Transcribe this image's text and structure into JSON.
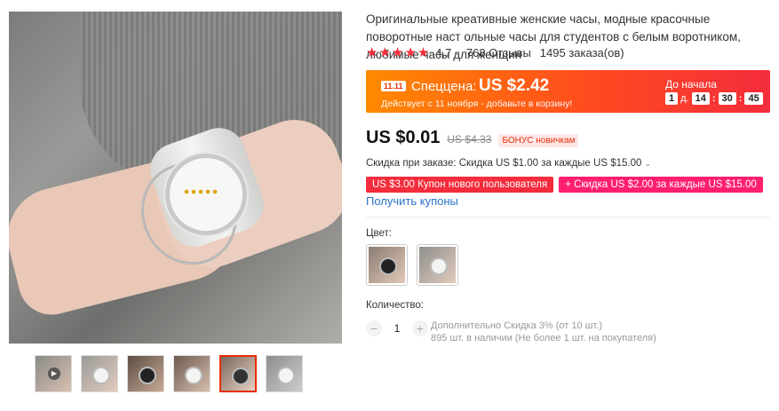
{
  "product": {
    "title": "Оригинальные креативные женские часы, модные красочные поворотные наст ольные часы для студентов с белым воротником, любимые часы для женщин",
    "stars": "★★★★★",
    "rating": "4.7",
    "reviews": "768 Отзывы",
    "orders": "1495 заказа(ов)"
  },
  "promo_banner": {
    "badge": "11.11",
    "special_label": "Спеццена:",
    "special_price": "US $2.42",
    "subtitle": "Действует с 11 ноября - добавьте в корзину!",
    "countdown_label": "До начала",
    "days": "1",
    "days_unit": "д.",
    "hours": "14",
    "minutes": "30",
    "seconds": "45",
    "sep": ":"
  },
  "price": {
    "current": "US $0.01",
    "old": "US $4.33",
    "bonus": "БОНУС новичкам"
  },
  "discount": {
    "text": "Скидка при заказе: Скидка US $1.00 за каждые US $15.00"
  },
  "coupons": [
    {
      "label": "US $3.00 Купон нового пользователя"
    },
    {
      "label": "+ Скидка US $2.00 за каждые US $15.00"
    }
  ],
  "get_coupons": "Получить купоны",
  "color": {
    "label": "Цвет:"
  },
  "quantity": {
    "label": "Количество:",
    "minus": "−",
    "value": "1",
    "plus": "+",
    "info_line1": "Дополнительно Скидка 3% (от 10 шт.)",
    "info_line2": "895 шт. в наличии (Не более 1 шт. на покупателя)"
  },
  "icons": {
    "play": "▶",
    "chevron": "⌄"
  },
  "colors": {
    "accent": "#e62e04",
    "star": "#f42c3b",
    "link": "#2a73c7"
  }
}
